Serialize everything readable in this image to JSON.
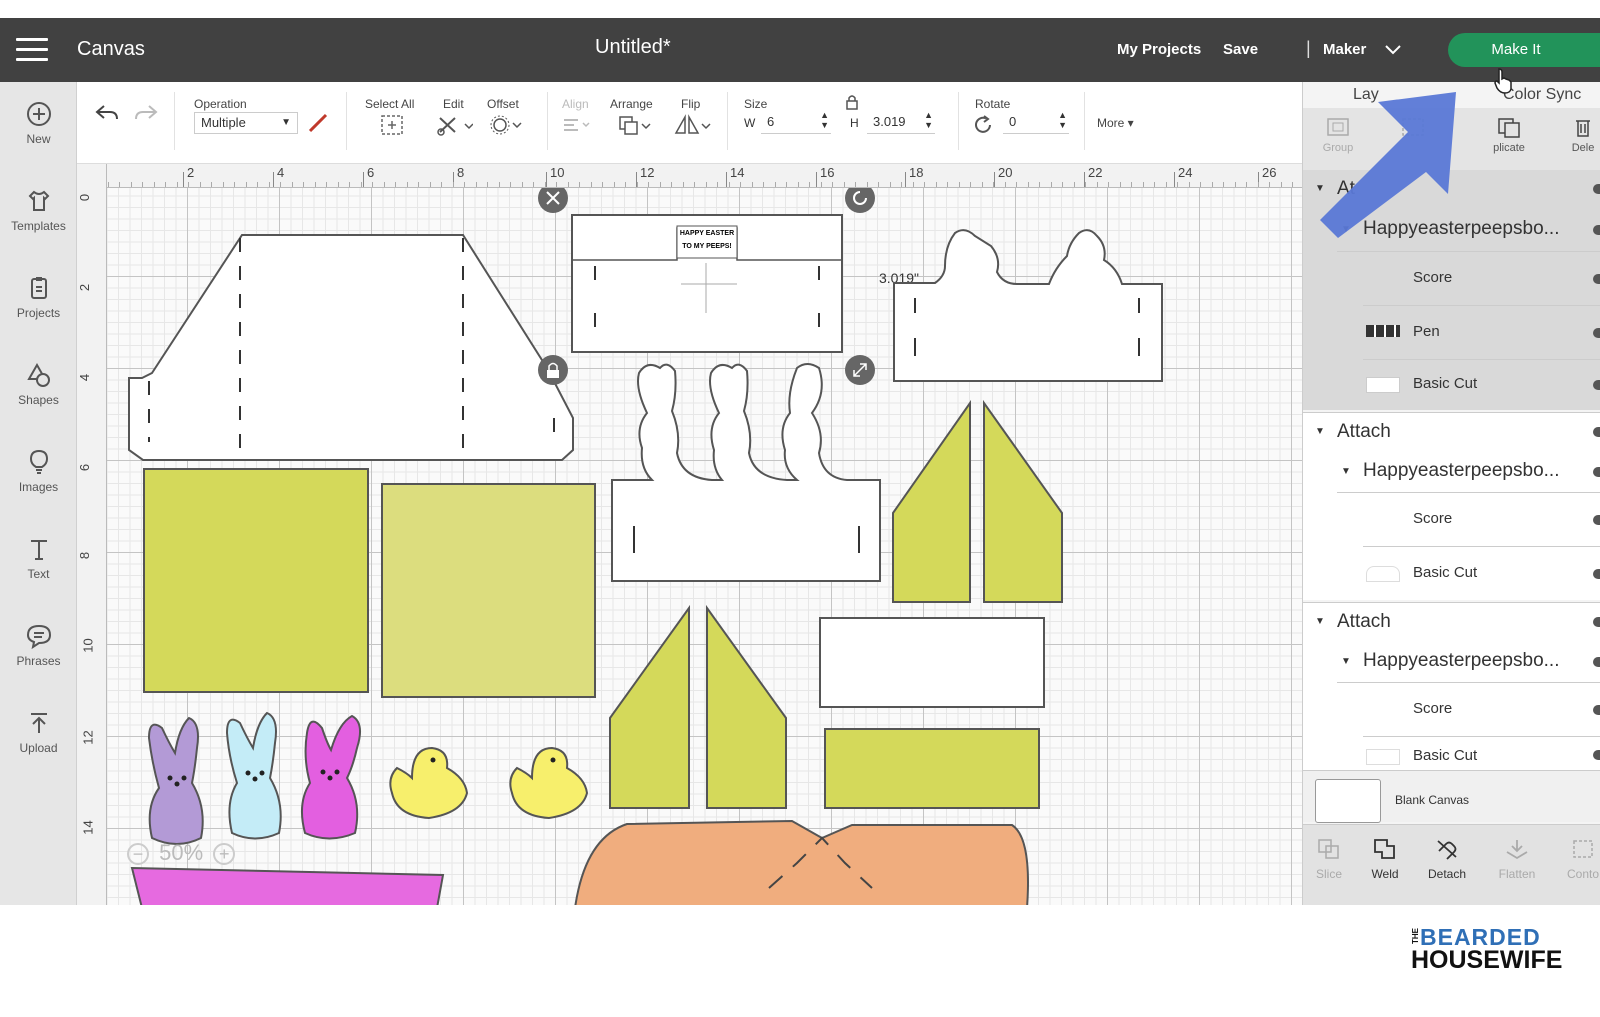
{
  "topbar": {
    "title": "Canvas",
    "document": "Untitled*",
    "my_projects": "My Projects",
    "save": "Save",
    "divider": "|",
    "machine": "Maker",
    "make_it": "Make It"
  },
  "sidebar": {
    "items": [
      {
        "label": "New",
        "icon": "plus-circle-icon"
      },
      {
        "label": "Templates",
        "icon": "shirt-icon"
      },
      {
        "label": "Projects",
        "icon": "projects-icon"
      },
      {
        "label": "Shapes",
        "icon": "shapes-icon"
      },
      {
        "label": "Images",
        "icon": "lightbulb-icon"
      },
      {
        "label": "Text",
        "icon": "text-icon"
      },
      {
        "label": "Phrases",
        "icon": "speech-bubble-icon"
      },
      {
        "label": "Upload",
        "icon": "upload-icon"
      }
    ]
  },
  "toolbar": {
    "operation_label": "Operation",
    "operation_value": "Multiple",
    "select_all": "Select All",
    "edit": "Edit",
    "offset": "Offset",
    "align": "Align",
    "arrange": "Arrange",
    "flip": "Flip",
    "size": "Size",
    "w_label": "W",
    "w_value": "6",
    "h_label": "H",
    "h_value": "3.019",
    "rotate": "Rotate",
    "rotate_value": "0",
    "more": "More ▾"
  },
  "ruler": {
    "top": [
      "2",
      "4",
      "6",
      "8",
      "10",
      "12",
      "14",
      "16",
      "18",
      "20",
      "22",
      "24",
      "26"
    ],
    "left": [
      "0",
      "2",
      "4",
      "6",
      "8",
      "10",
      "12",
      "14"
    ]
  },
  "canvas": {
    "dimension_label": "3.019\"",
    "card_text_1": "HAPPY EASTER",
    "card_text_2": "TO MY PEEPS!",
    "zoom": "50%",
    "zoom_minus": "−",
    "zoom_plus": "+"
  },
  "panel": {
    "tabs": [
      "Lay",
      "Color Sync"
    ],
    "actions": [
      "Group",
      "",
      "plicate",
      "Dele"
    ],
    "layers": [
      {
        "group": "At",
        "name": "Happyeasterpeepsbo...",
        "items": [
          "Score",
          "Pen",
          "Basic Cut"
        ]
      },
      {
        "group": "Attach",
        "name": "Happyeasterpeepsbo...",
        "items": [
          "Score",
          "Basic Cut"
        ]
      },
      {
        "group": "Attach",
        "name": "Happyeasterpeepsbo...",
        "items": [
          "Score",
          "Basic Cut"
        ]
      }
    ],
    "blank_canvas": "Blank Canvas",
    "bottom_actions": [
      "Slice",
      "Weld",
      "Detach",
      "Flatten",
      "Conto"
    ]
  },
  "brand": {
    "the": "THE",
    "line1": "BEARDED",
    "line2": "HOUSEWIFE"
  },
  "colors": {
    "topbar": "#414141",
    "make_it": "#22935a",
    "arrow": "#5a78d6",
    "green_box": "#d4d95a",
    "light_green_box": "#dcdd7e",
    "peep_purple": "#b39ad6",
    "peep_blue": "#c4ecf7",
    "peep_pink": "#e35fe0",
    "peep_yellow": "#f7ef6c",
    "orange_basket": "#f0ad7e",
    "pink_basket": "#e66ae0"
  }
}
